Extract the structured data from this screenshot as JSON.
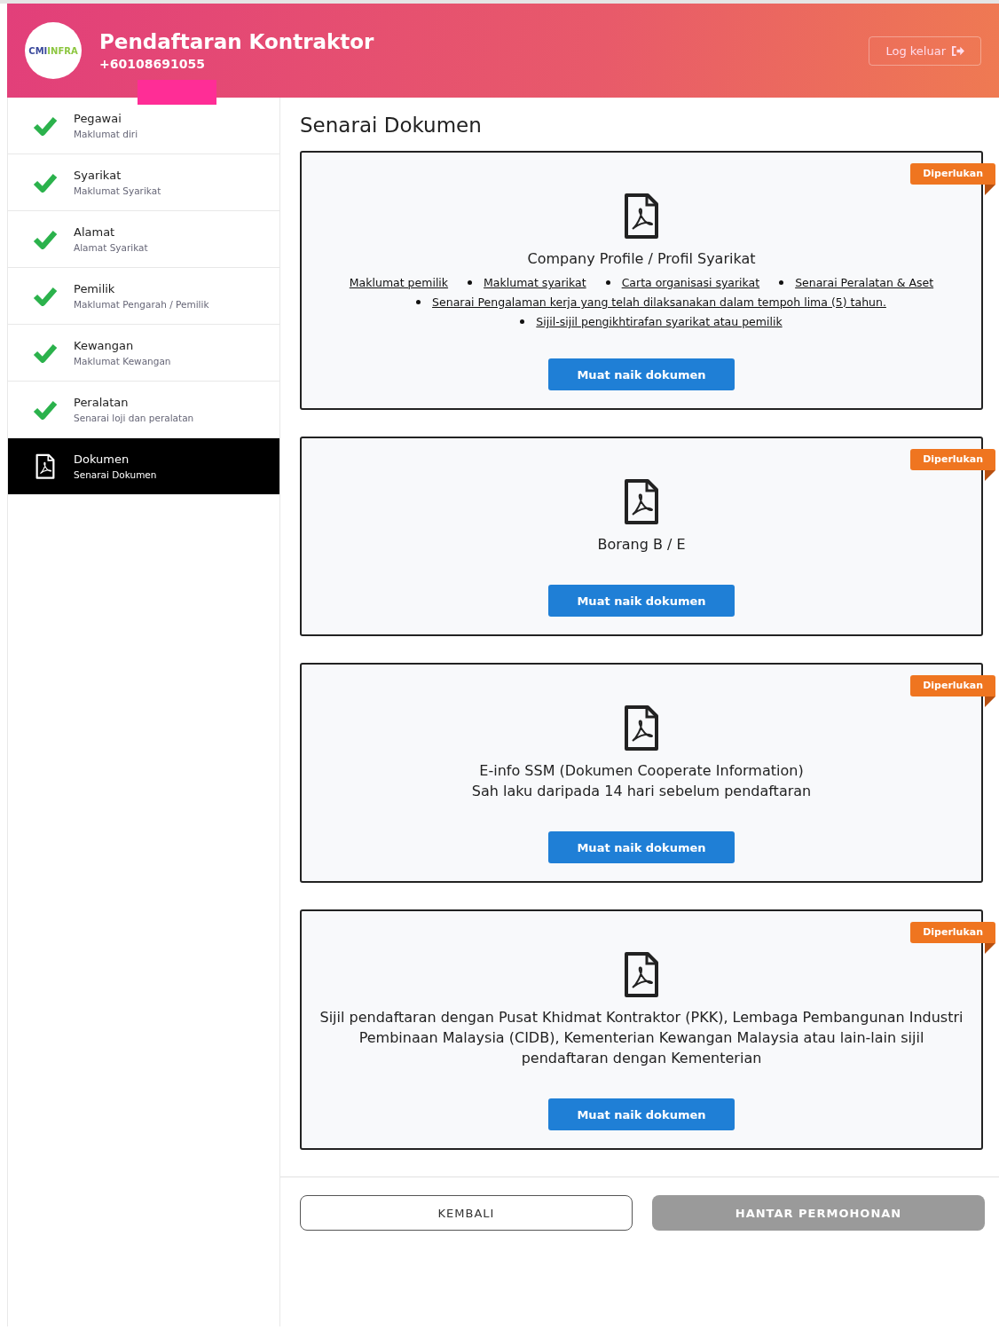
{
  "header": {
    "logo": {
      "part_1": "CMI",
      "part_2": "INFRA"
    },
    "title": "Pendaftaran Kontraktor",
    "phone": "+60108691055",
    "logout": "Log keluar",
    "redacted": true
  },
  "sidebar": {
    "items": [
      {
        "title": "Pegawai",
        "subtitle": "Maklumat diri",
        "completed": true,
        "selected": false
      },
      {
        "title": "Syarikat",
        "subtitle": "Maklumat Syarikat",
        "completed": true,
        "selected": false
      },
      {
        "title": "Alamat",
        "subtitle": "Alamat Syarikat",
        "completed": true,
        "selected": false
      },
      {
        "title": "Pemilik",
        "subtitle": "Maklumat Pengarah / Pemilik",
        "completed": true,
        "selected": false
      },
      {
        "title": "Kewangan",
        "subtitle": "Maklumat Kewangan",
        "completed": true,
        "selected": false
      },
      {
        "title": "Peralatan",
        "subtitle": "Senarai loji dan peralatan",
        "completed": true,
        "selected": false
      },
      {
        "title": "Dokumen",
        "subtitle": "Senarai Dokumen",
        "completed": false,
        "selected": true
      }
    ]
  },
  "main": {
    "heading": "Senarai Dokumen",
    "documents": [
      {
        "badge": "Diperlukan",
        "title_lines": [
          "Company Profile / Profil Syarikat"
        ],
        "links": [
          [
            "Maklumat pemilik",
            "Maklumat syarikat",
            "Carta organisasi syarikat",
            "Senarai Peralatan & Aset"
          ],
          [
            "Senarai Pengalaman kerja yang telah dilaksanakan dalam tempoh lima (5) tahun."
          ],
          [
            "Sijil-sijil pengikhtirafan syarikat atau pemilik"
          ]
        ],
        "button": "Muat naik dokumen"
      },
      {
        "badge": "Diperlukan",
        "title_lines": [
          "Borang B / E"
        ],
        "button": "Muat naik dokumen"
      },
      {
        "badge": "Diperlukan",
        "title_lines": [
          "E-info SSM (Dokumen Cooperate Information)",
          "Sah laku daripada 14 hari sebelum pendaftaran"
        ],
        "button": "Muat naik dokumen"
      },
      {
        "badge": "Diperlukan",
        "title_lines": [
          "Sijil pendaftaran dengan Pusat Khidmat Kontraktor (PKK), Lembaga Pembangunan Industri Pembinaan Malaysia (CIDB), Kementerian Kewangan Malaysia atau lain-lain sijil pendaftaran dengan Kementerian"
        ],
        "button": "Muat naik dokumen"
      }
    ]
  },
  "footer": {
    "back": "KEMBALI",
    "submit": {
      "label": "HANTAR PERMOHONAN",
      "disabled": true
    }
  }
}
